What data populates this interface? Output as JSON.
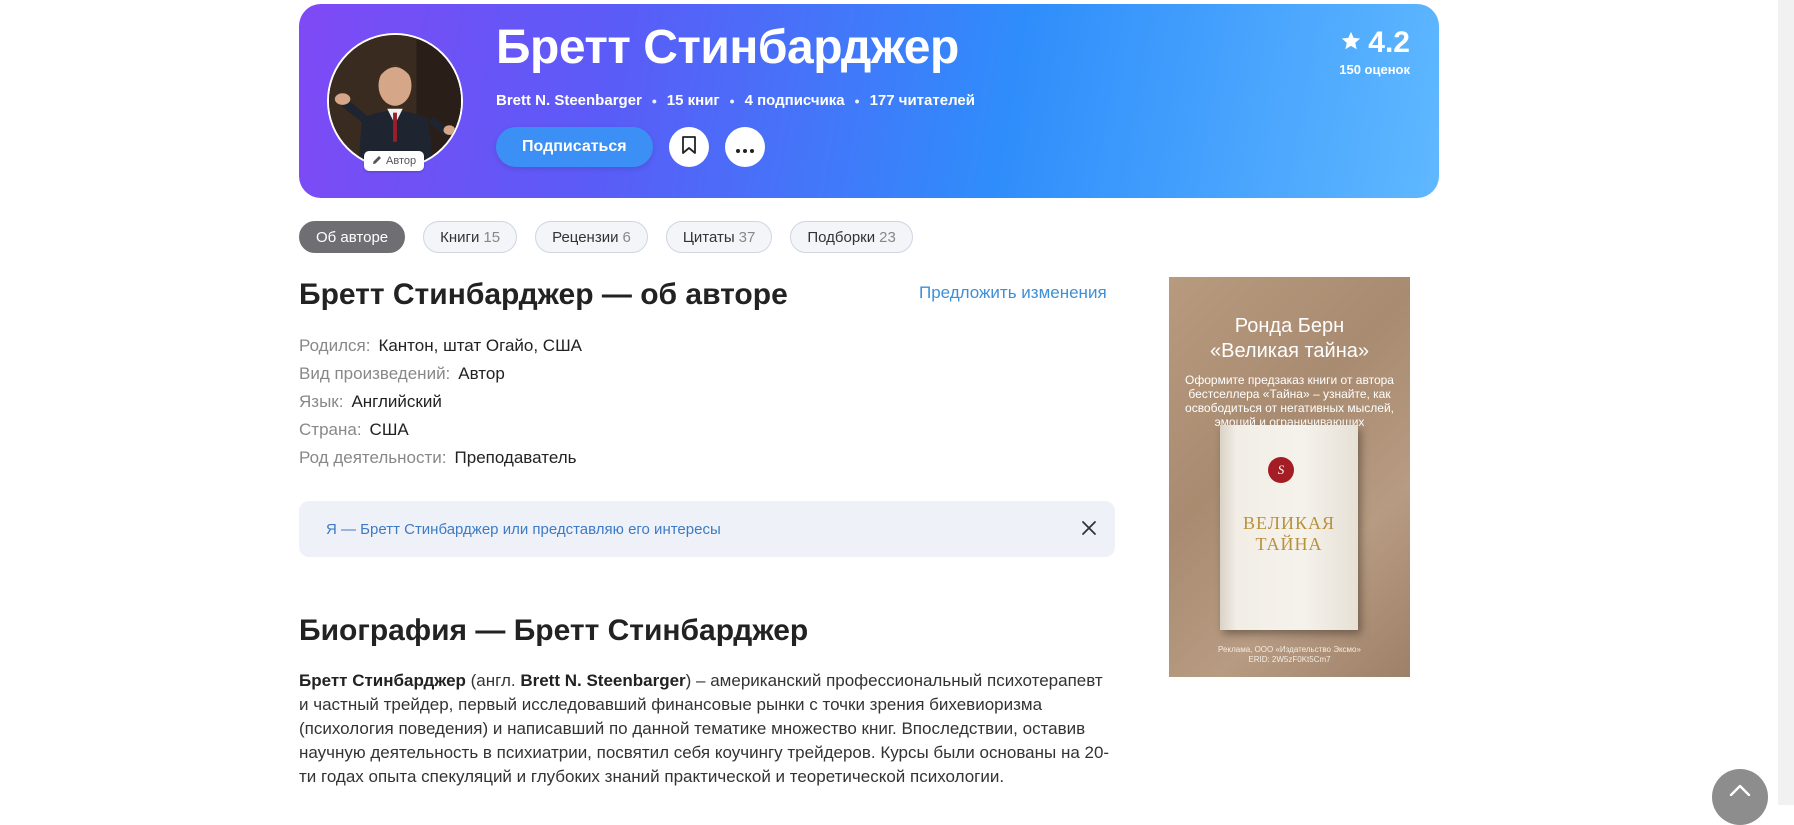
{
  "author": {
    "name": "Бретт Стинбарджер",
    "original_name": "Brett N. Steenbarger",
    "books": "15 книг",
    "subscribers": "4 подписчика",
    "readers": "177 читателей",
    "badge": "Автор"
  },
  "actions": {
    "subscribe": "Подписаться",
    "bookmark_icon": "bookmark-icon",
    "more_icon": "more-icon"
  },
  "rating": {
    "value": "4.2",
    "count": "150 оценок"
  },
  "tabs": [
    {
      "label": "Об авторе",
      "count": "",
      "active": true
    },
    {
      "label": "Книги",
      "count": "15"
    },
    {
      "label": "Рецензии",
      "count": "6"
    },
    {
      "label": "Цитаты",
      "count": "37"
    },
    {
      "label": "Подборки",
      "count": "23"
    }
  ],
  "about": {
    "title": "Бретт Стинбарджер — об авторе",
    "suggest": "Предложить изменения",
    "facts": [
      {
        "label": "Родился:",
        "value": "Кантон, штат Огайо, США"
      },
      {
        "label": "Вид произведений:",
        "value": "Автор"
      },
      {
        "label": "Язык:",
        "value": "Английский"
      },
      {
        "label": "Страна:",
        "value": "США"
      },
      {
        "label": "Род деятельности:",
        "value": "Преподаватель"
      }
    ]
  },
  "claim": {
    "text": "Я — Бретт Стинбарджер или представляю его интересы"
  },
  "bio": {
    "title": "Биография — Бретт Стинбарджер",
    "name_bold": "Бретт Стинбарджер",
    "eng_prefix": " (англ. ",
    "eng_bold": "Brett N. Steenbarger",
    "text": ") – американский профессиональный психотерапевт и частный трейдер, первый исследовавший финансовые рынки с точки зрения бихевиоризма (психология поведения) и написавший по данной тематике множество книг. Впоследствии, оставив научную деятельность в психиатрии, посвятил себя коучингу трейдеров. Курсы были основаны на 20-ти годах опыта спекуляций и глубоких знаний практической и теоретической психологии."
  },
  "ad": {
    "author": "Ронда Берн",
    "title": "«Великая тайна»",
    "description": "Оформите предзаказ книги от автора бестселлера «Тайна» – узнайте, как освободиться от негативных мыслей, эмоций и ограничивающих убеждений",
    "book_title_line1": "ВЕЛИКАЯ",
    "book_title_line2": "ТАЙНА",
    "book_seal": "S",
    "legal_line1": "Реклама, ООО «Издательство Эксмо»",
    "legal_line2": "ERID: 2W5zF0Kt5Cm7"
  },
  "colors": {
    "hero_start": "#7f49f6",
    "hero_end": "#5fb8ff",
    "link": "#3d8fd6",
    "subscribe": "#3c8ff4"
  }
}
